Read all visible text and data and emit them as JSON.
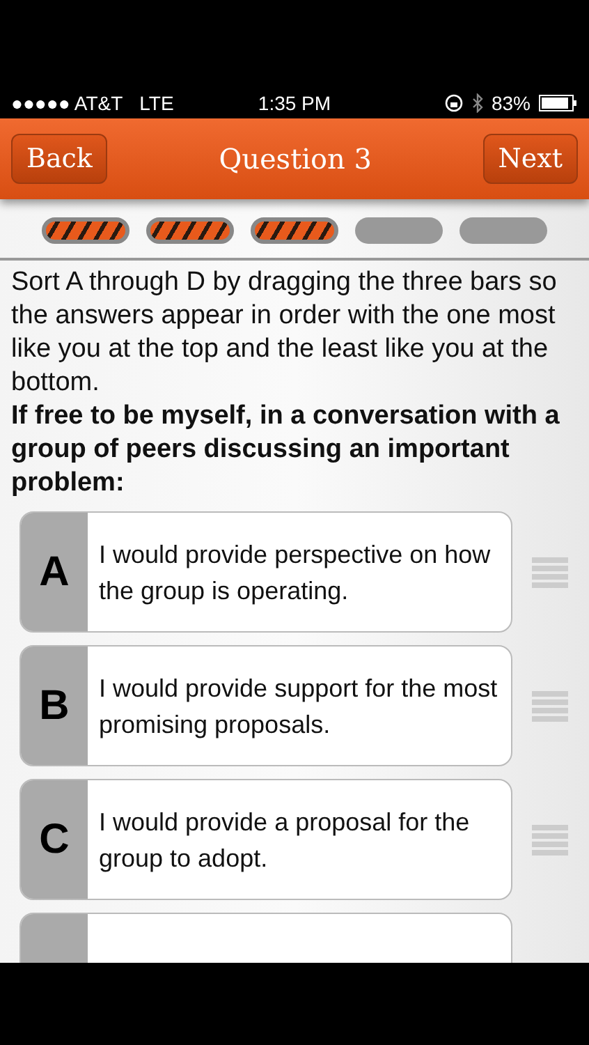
{
  "status_bar": {
    "carrier": "●●●●● AT&T",
    "network": "LTE",
    "time": "1:35 PM",
    "battery": "83%"
  },
  "nav": {
    "back": "Back",
    "title": "Question 3",
    "next": "Next"
  },
  "progress": [
    {
      "done": true
    },
    {
      "done": true
    },
    {
      "done": true
    },
    {
      "done": false
    },
    {
      "done": false
    }
  ],
  "instructions": "Sort A through D by dragging the three bars so the answers appear in order with the one most like you at the top and the least like you at the bottom.",
  "prompt": "If free to be myself, in a conversation with a group of peers discussing an important problem:",
  "answers": [
    {
      "letter": "A",
      "text": "I would provide perspective on how the group is operating."
    },
    {
      "letter": "B",
      "text": "I would provide support for the most promising proposals."
    },
    {
      "letter": "C",
      "text": "I would provide a proposal for the group to adopt."
    },
    {
      "kind": "partial"
    }
  ]
}
